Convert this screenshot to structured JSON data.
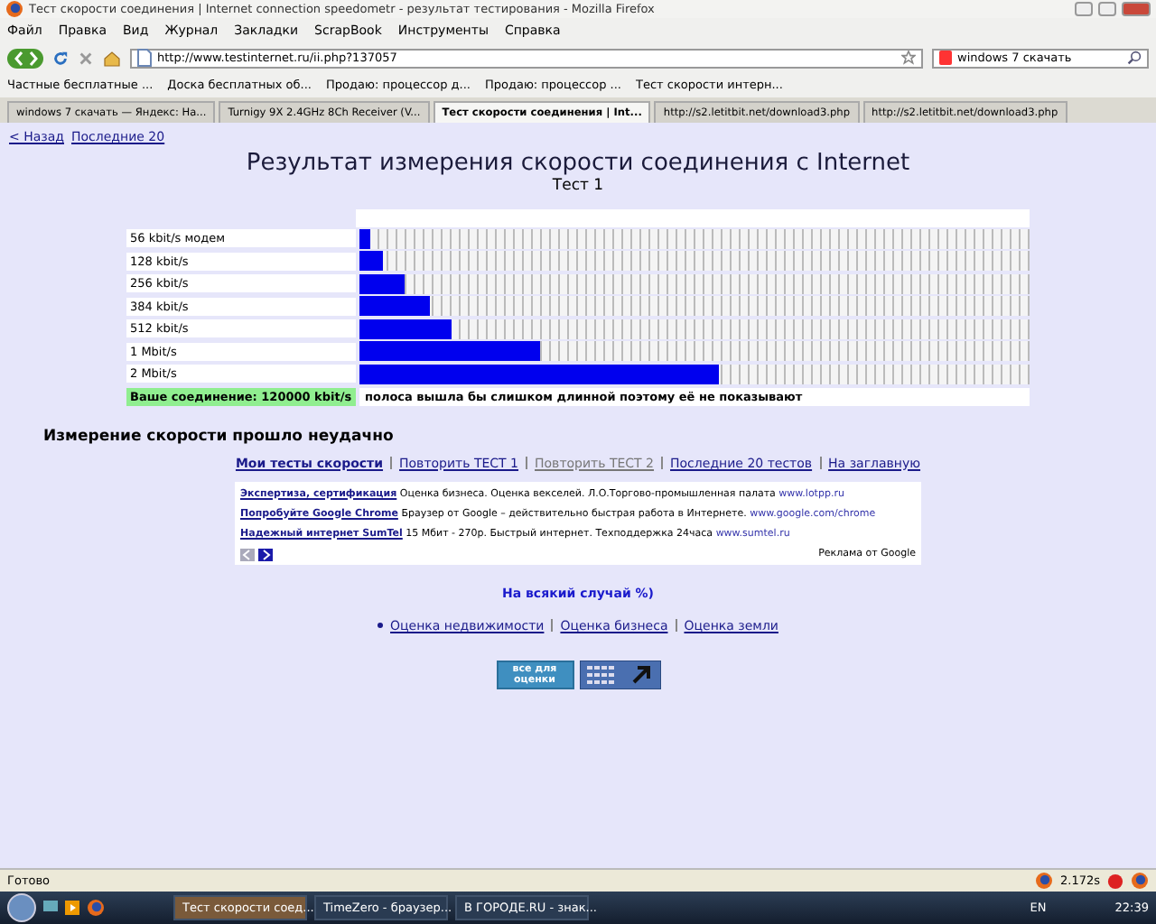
{
  "window": {
    "title": "Тест скорости соединения | Internet connection speedometr - результат тестирования - Mozilla Firefox"
  },
  "menu": [
    "Файл",
    "Правка",
    "Вид",
    "Журнал",
    "Закладки",
    "ScrapBook",
    "Инструменты",
    "Справка"
  ],
  "address": {
    "value": "http://www.testinternet.ru/ii.php?137057"
  },
  "search": {
    "value": "windows 7 скачать"
  },
  "bookmarks": [
    "Частные бесплатные ...",
    "Доска бесплатных об...",
    "Продаю: процессор д...",
    "Продаю: процессор ...",
    "Тест скорости интерн..."
  ],
  "tabs": [
    {
      "label": "windows 7 скачать — Яндекс: На...",
      "selected": false
    },
    {
      "label": "Turnigy 9X 2.4GHz 8Ch Receiver (V...",
      "selected": false
    },
    {
      "label": "Тест скорости соединения | Int...",
      "selected": true
    },
    {
      "label": "http://s2.letitbit.net/download3.php",
      "selected": false
    },
    {
      "label": "http://s2.letitbit.net/download3.php",
      "selected": false
    }
  ],
  "top_links": [
    "< Назад",
    "Последние 20"
  ],
  "heading": "Результат измерения скорости соединения с Internet",
  "subheading": "Тест 1",
  "speed_rows": [
    {
      "name": "56 kbit/s модем",
      "level": 0.016
    },
    {
      "name": "128 kbit/s",
      "level": 0.035
    },
    {
      "name": "256 kbit/s",
      "level": 0.068
    },
    {
      "name": "384 kbit/s",
      "level": 0.104
    },
    {
      "name": "512 kbit/s",
      "level": 0.137
    },
    {
      "name": "1 Mbit/s",
      "level": 0.27
    },
    {
      "name": "2 Mbit/s",
      "level": 0.537
    }
  ],
  "result": {
    "label": "Ваше соединение: 120000 kbit/s",
    "note": "полоса вышла бы слишком длинной поэтому её не показывают"
  },
  "status_message": "Измерение скорости прошло неудачно",
  "nav_links": [
    {
      "label": "Мои тесты скорости",
      "kind": "current"
    },
    {
      "label": "Повторить ТЕСТ 1",
      "kind": "link"
    },
    {
      "label": "Повторить ТЕСТ 2",
      "kind": "visited"
    },
    {
      "label": "Последние 20 тестов",
      "kind": "link"
    },
    {
      "label": "На заглавную",
      "kind": "link"
    }
  ],
  "ads": [
    {
      "title": "Экспертиза, сертификация",
      "text": "Оценка бизнеса. Оценка векселей. Л.О.Торгово-промышленная палата",
      "url": "www.lotpp.ru"
    },
    {
      "title": "Попробуйте Google Chrome",
      "text": "Браузер от Google – действительно быстрая работа в Интернете.",
      "url": "www.google.com/chrome"
    },
    {
      "title": "Надежный интернет SumTel",
      "text": "15 Мбит - 270р. Быстрый интернет. Техподдержка 24часа",
      "url": "www.sumtel.ru"
    }
  ],
  "ads_credit": "Реклама от Google",
  "just_in_case": "На всякий случай %)",
  "valuation_links": [
    "Оценка недвижимости",
    "Оценка бизнеса",
    "Оценка земли"
  ],
  "banner": {
    "label": "все для оценки"
  },
  "status_bar": {
    "text": "Готово",
    "timing": "2.172s"
  },
  "taskbar": {
    "tasks": [
      {
        "label": "Тест скорости соед...",
        "selected": true
      },
      {
        "label": "TimeZero - браузер...",
        "selected": false
      },
      {
        "label": "В ГОРОДЕ.RU - знак...",
        "selected": false
      }
    ],
    "language": "EN",
    "clock": "22:39"
  }
}
